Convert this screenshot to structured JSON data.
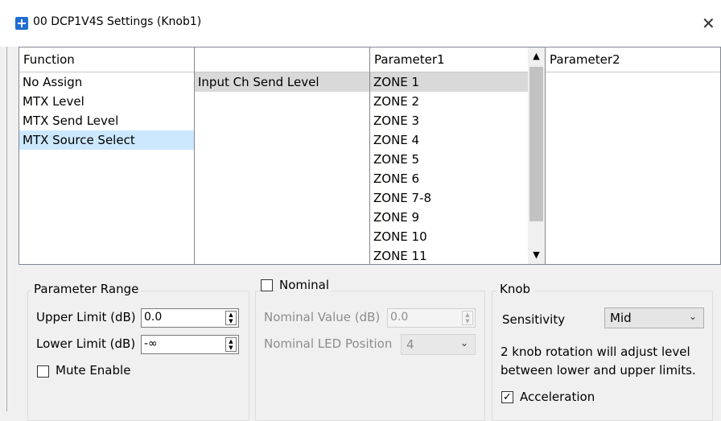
{
  "window": {
    "title": "00 DCP1V4S Settings (Knob1)",
    "close_glyph": "✕"
  },
  "columns": {
    "function": {
      "header": "Function",
      "items": [
        "No Assign",
        "MTX Level",
        "MTX Send Level",
        "MTX Source Select"
      ],
      "selected_index": 3
    },
    "sub": {
      "header": "",
      "items": [
        "Input Ch Send Level"
      ],
      "selected_index": 0
    },
    "parameter1": {
      "header": "Parameter1",
      "items": [
        "ZONE 1",
        "ZONE 2",
        "ZONE 3",
        "ZONE 4",
        "ZONE 5",
        "ZONE 6",
        "ZONE 7-8",
        "ZONE 9",
        "ZONE 10",
        "ZONE 11"
      ],
      "selected_index": 0
    },
    "parameter2": {
      "header": "Parameter2",
      "items": []
    }
  },
  "parameter_range": {
    "title": "Parameter Range",
    "upper_label": "Upper Limit (dB)",
    "upper_value": "0.0",
    "lower_label": "Lower Limit (dB)",
    "lower_value": "-∞",
    "mute_label": "Mute Enable",
    "mute_checked": false
  },
  "nominal": {
    "title": "Nominal",
    "checked": false,
    "value_label": "Nominal Value (dB)",
    "value": "0.0",
    "led_label": "Nominal LED Position",
    "led_value": "4"
  },
  "knob": {
    "title": "Knob",
    "sensitivity_label": "Sensitivity",
    "sensitivity_value": "Mid",
    "info_line1": "2 knob rotation will adjust level",
    "info_line2": "between lower and upper limits.",
    "acceleration_label": "Acceleration",
    "acceleration_checked": true
  },
  "icons": {
    "check": "✓",
    "chevron": "⌄",
    "scroll_up": "▲",
    "scroll_down": "▼",
    "spin_up": "▲",
    "spin_down": "▼"
  }
}
